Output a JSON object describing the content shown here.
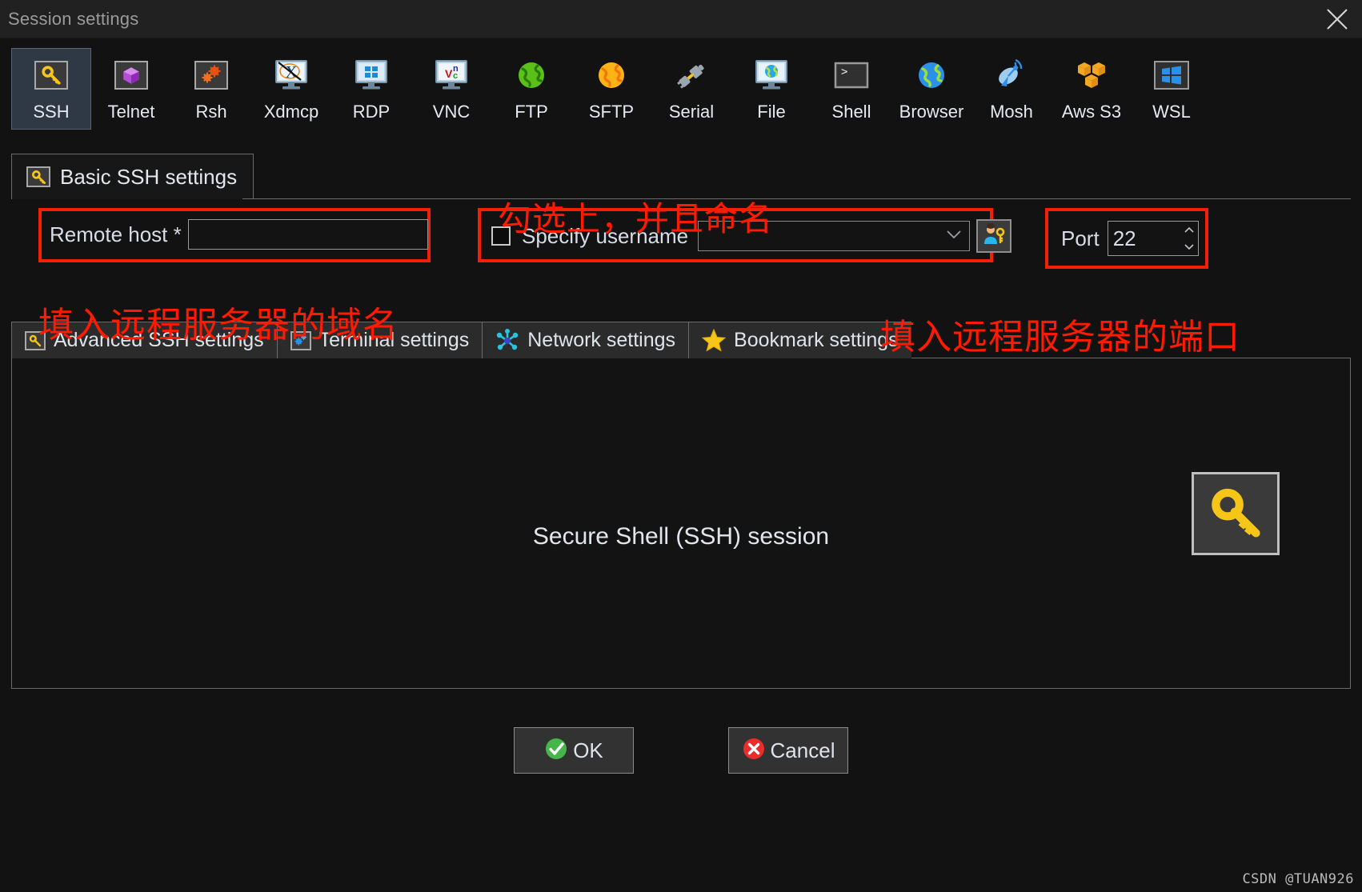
{
  "window": {
    "title": "Session settings",
    "close_icon": "close-icon"
  },
  "session_types": [
    {
      "label": "SSH",
      "icon": "key-icon",
      "selected": true
    },
    {
      "label": "Telnet",
      "icon": "purple-gem-icon",
      "selected": false
    },
    {
      "label": "Rsh",
      "icon": "orange-gears-icon",
      "selected": false
    },
    {
      "label": "Xdmcp",
      "icon": "x-monitor-icon",
      "selected": false
    },
    {
      "label": "RDP",
      "icon": "windows-monitor-icon",
      "selected": false
    },
    {
      "label": "VNC",
      "icon": "vnc-monitor-icon",
      "selected": false
    },
    {
      "label": "FTP",
      "icon": "green-globe-icon",
      "selected": false
    },
    {
      "label": "SFTP",
      "icon": "orange-globe-icon",
      "selected": false
    },
    {
      "label": "Serial",
      "icon": "plug-icon",
      "selected": false
    },
    {
      "label": "File",
      "icon": "globe-monitor-icon",
      "selected": false
    },
    {
      "label": "Shell",
      "icon": "terminal-prompt-icon",
      "selected": false
    },
    {
      "label": "Browser",
      "icon": "blue-globe-icon",
      "selected": false
    },
    {
      "label": "Mosh",
      "icon": "satellite-dish-icon",
      "selected": false
    },
    {
      "label": "Aws S3",
      "icon": "aws-cubes-icon",
      "selected": false
    },
    {
      "label": "WSL",
      "icon": "windows-logo-icon",
      "selected": false
    }
  ],
  "basic_tab": {
    "label": "Basic SSH settings",
    "icon": "key-icon"
  },
  "form": {
    "remote_host_label": "Remote host *",
    "remote_host_value": "",
    "remote_host_placeholder": "",
    "specify_username_label": "Specify username",
    "specify_username_checked": false,
    "username_value": "",
    "username_dropdown_icon": "chevron-down-icon",
    "username_picker_icon": "user-key-icon",
    "port_label": "Port",
    "port_value": "22",
    "port_spinner_icon": "spinner-arrows-icon"
  },
  "annotations": [
    {
      "id": "top",
      "text": "勾选上，并且命名",
      "color": "#ff1a00"
    },
    {
      "id": "left",
      "text": "填入远程服务器的域名",
      "color": "#ff1a00"
    },
    {
      "id": "right",
      "text": "填入远程服务器的端口",
      "color": "#ff1a00"
    }
  ],
  "highlight_boxes": {
    "color": "#f41f05",
    "targets": [
      "remote-host",
      "specify-username",
      "port"
    ]
  },
  "sub_tabs": [
    {
      "label": "Advanced SSH settings",
      "icon": "key-icon",
      "active": false
    },
    {
      "label": "Terminal settings",
      "icon": "blue-gears-icon",
      "active": false
    },
    {
      "label": "Network settings",
      "icon": "network-nodes-icon",
      "active": false
    },
    {
      "label": "Bookmark settings",
      "icon": "star-icon",
      "active": false
    }
  ],
  "content": {
    "caption": "Secure Shell (SSH) session",
    "decorative_icon": "key-icon"
  },
  "buttons": [
    {
      "label": "OK",
      "icon": "green-check-icon"
    },
    {
      "label": "Cancel",
      "icon": "red-x-icon"
    }
  ],
  "watermark": "CSDN @TUAN926"
}
